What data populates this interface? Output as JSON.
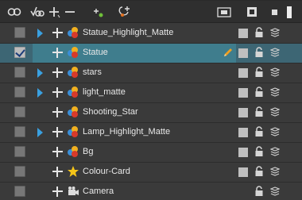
{
  "toolbar": {
    "icons": [
      "onion-skin-icon",
      "onion-skin-animated-icon",
      "add-remove-layer-icon",
      "add-peg-icon",
      "add-drawing-layer-icon",
      "film-strip-icon",
      "show-hide-all-icon",
      "square-icon",
      "timeline-bar-icon"
    ]
  },
  "layers": [
    {
      "name": "Statue_Highlight_Matte",
      "checked": false,
      "expandable": true,
      "selected": false,
      "type": "drawing",
      "color_swatch": true,
      "pencil": false
    },
    {
      "name": "Statue",
      "checked": true,
      "expandable": false,
      "selected": true,
      "type": "drawing",
      "color_swatch": true,
      "pencil": true
    },
    {
      "name": "stars",
      "checked": false,
      "expandable": true,
      "selected": false,
      "type": "drawing",
      "color_swatch": true,
      "pencil": false
    },
    {
      "name": "light_matte",
      "checked": false,
      "expandable": true,
      "selected": false,
      "type": "drawing",
      "color_swatch": true,
      "pencil": false
    },
    {
      "name": "Shooting_Star",
      "checked": false,
      "expandable": false,
      "selected": false,
      "type": "drawing",
      "color_swatch": true,
      "pencil": false
    },
    {
      "name": "Lamp_Highlight_Matte",
      "checked": false,
      "expandable": true,
      "selected": false,
      "type": "drawing",
      "color_swatch": true,
      "pencil": false
    },
    {
      "name": "Bg",
      "checked": false,
      "expandable": false,
      "selected": false,
      "type": "drawing",
      "color_swatch": true,
      "pencil": false
    },
    {
      "name": "Colour-Card",
      "checked": false,
      "expandable": false,
      "selected": false,
      "type": "colour-card",
      "color_swatch": true,
      "pencil": false
    },
    {
      "name": "Camera",
      "checked": false,
      "expandable": false,
      "selected": false,
      "type": "camera",
      "color_swatch": false,
      "pencil": false
    }
  ],
  "colors": {
    "panel_bg": "#3a3a3a",
    "selected_row": "#3f7d8d",
    "expand_arrow": "#3aa0e0",
    "pencil": "#f0a020"
  }
}
